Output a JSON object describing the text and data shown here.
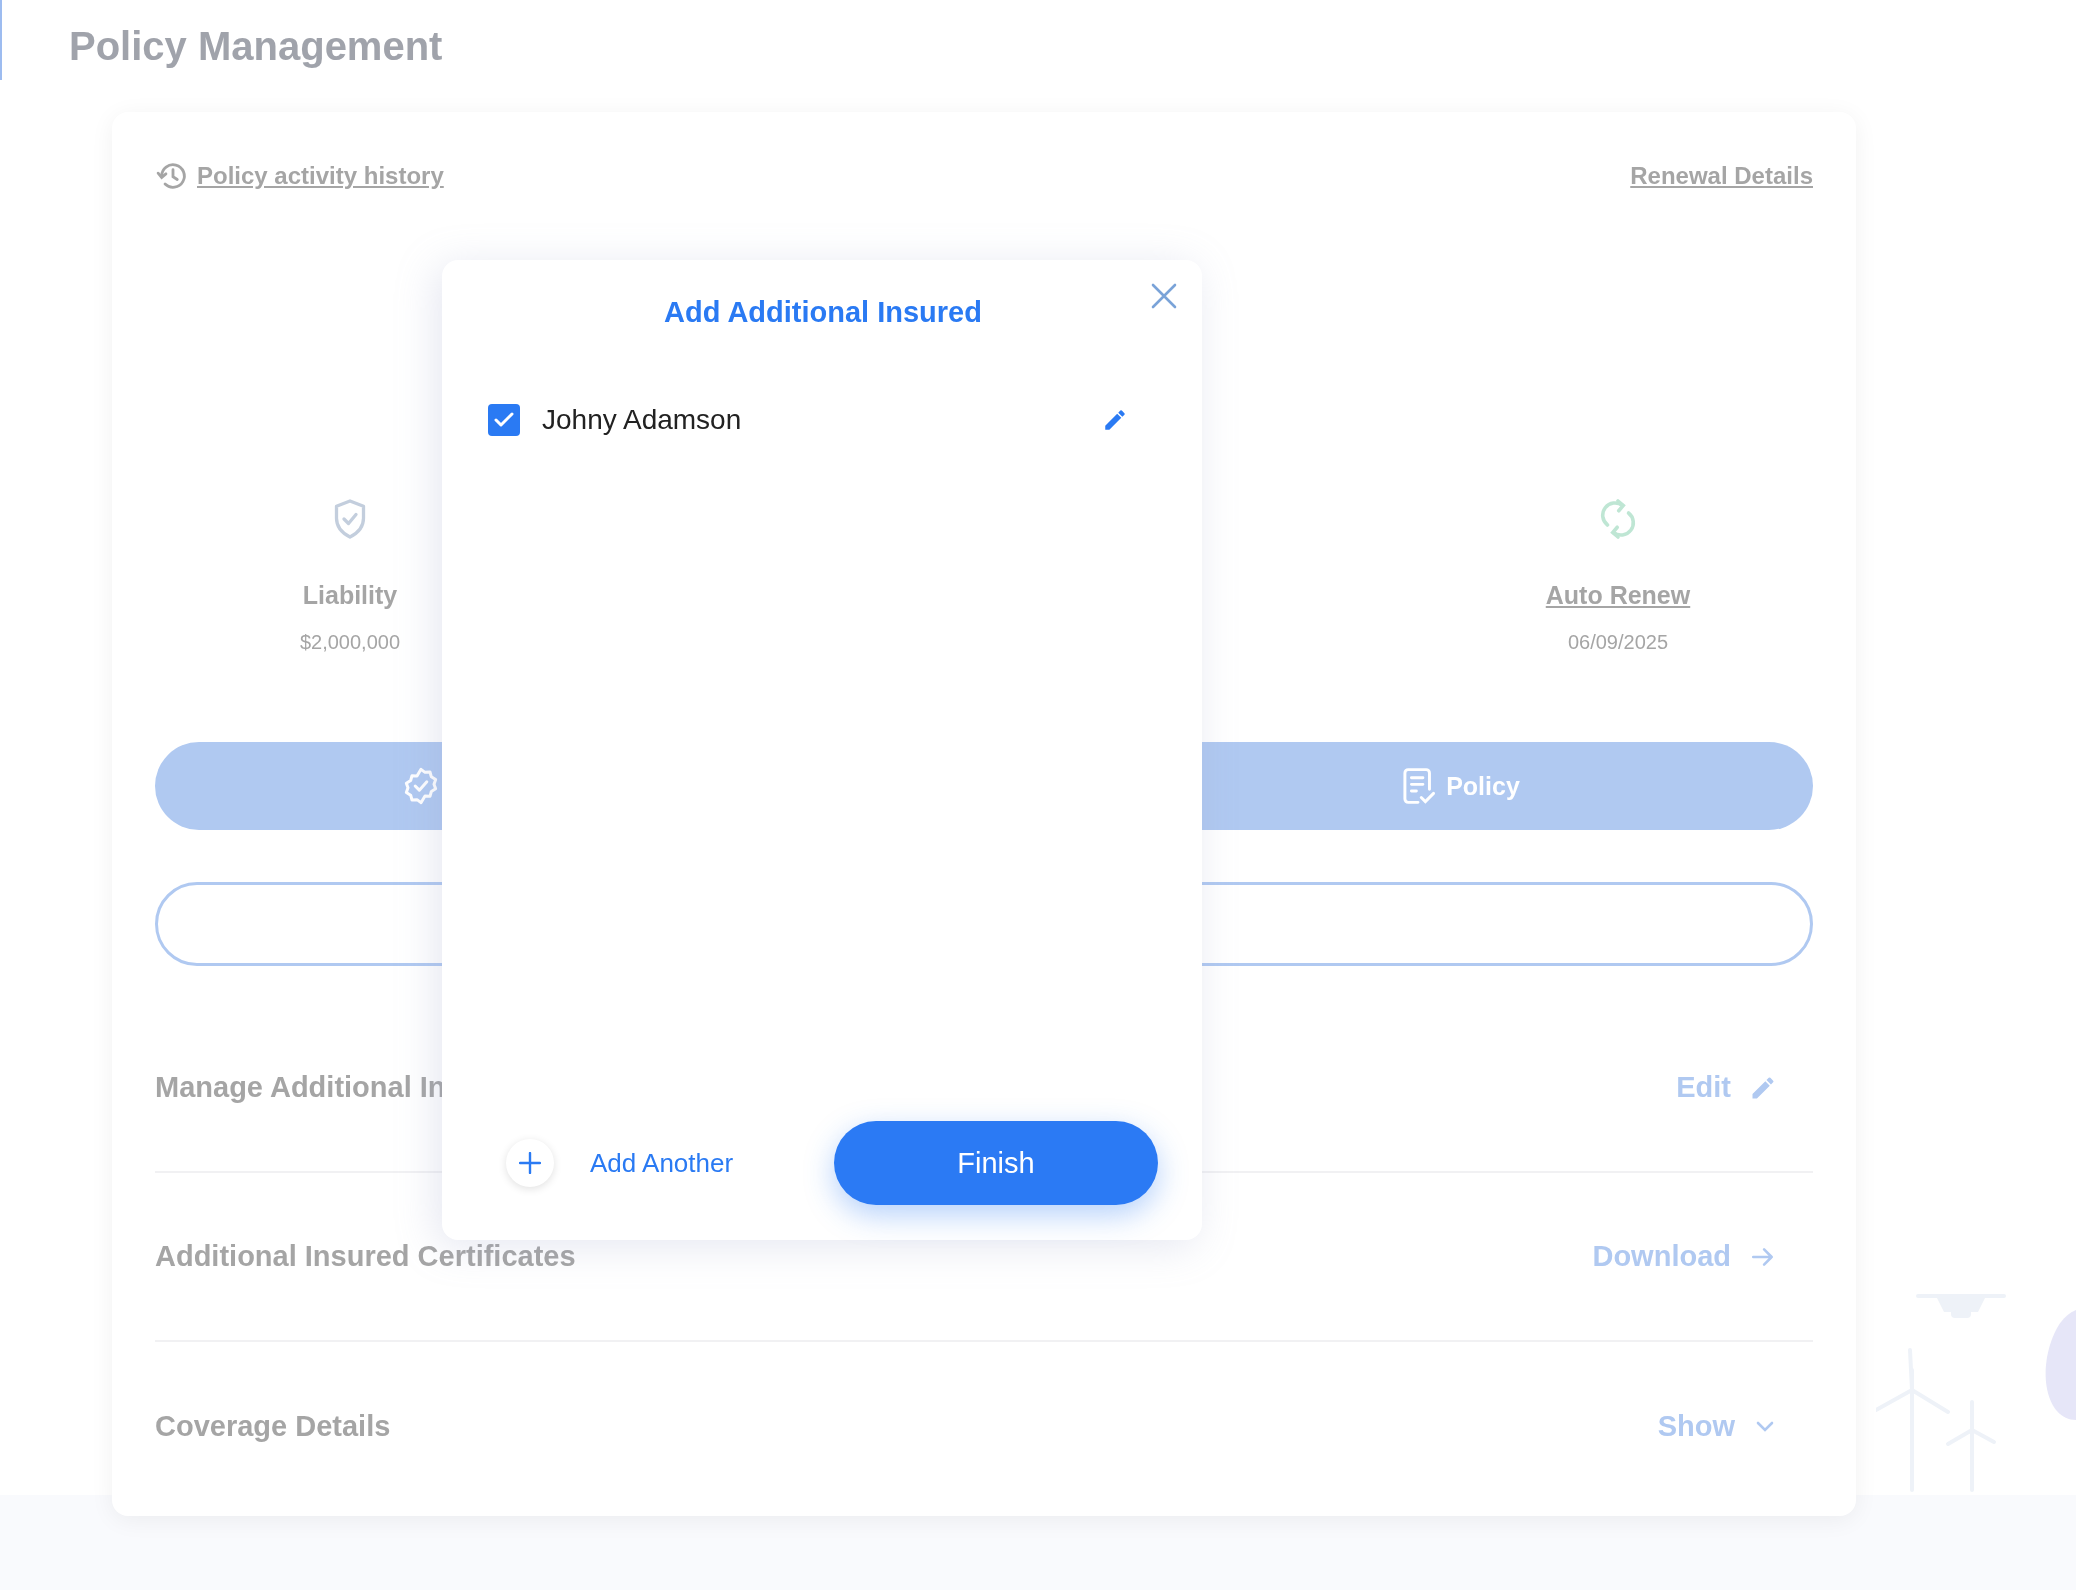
{
  "page": {
    "title": "Policy Management"
  },
  "card": {
    "history_link": "Policy activity history",
    "renewal_link": "Renewal Details",
    "stats": [
      {
        "kind": "liability",
        "label": "Liability",
        "value": "$2,000,000",
        "link": false
      },
      {
        "kind": "renew",
        "label": "Auto Renew",
        "value": "06/09/2025",
        "link": true
      }
    ],
    "pill_buttons": [
      {
        "kind": "badge"
      },
      {
        "kind": "document",
        "label": "Policy"
      }
    ],
    "rows": [
      {
        "kind": "edit",
        "label": "Manage Additional In",
        "action": "Edit"
      },
      {
        "kind": "download",
        "label": "Additional Insured Certificates",
        "action": "Download"
      },
      {
        "kind": "expand",
        "label": "Coverage Details",
        "action": "Show"
      }
    ]
  },
  "modal": {
    "title": "Add Additional Insured",
    "insured": [
      {
        "name": "Johny Adamson",
        "checked": true
      }
    ],
    "add_label": "Add Another",
    "finish_label": "Finish"
  }
}
